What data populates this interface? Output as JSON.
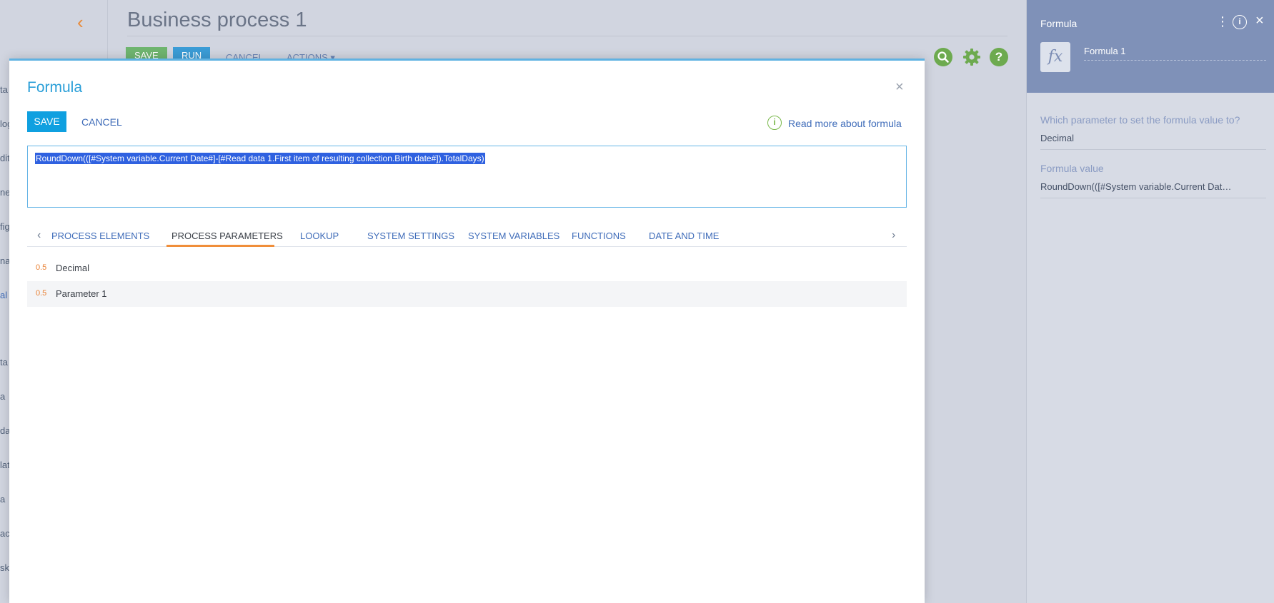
{
  "background": {
    "page_title": "Business process 1",
    "toolbar": {
      "save_label": "SAVE",
      "run_label": "RUN",
      "cancel_label": "CANCEL",
      "actions_label": "ACTIONS ▾"
    },
    "left_fragments": [
      "ta",
      "log",
      "dit",
      "ne",
      "fig",
      "nai",
      "al",
      "ta",
      "a",
      "dat",
      "lat",
      "a",
      "ac",
      "sk"
    ]
  },
  "right_panel": {
    "title": "Formula",
    "element_name": "Formula 1",
    "param_label": "Which parameter to set the formula value to?",
    "param_value": "Decimal",
    "formula_label": "Formula value",
    "formula_value": "RoundDown(([#System variable.Current Dat…"
  },
  "modal": {
    "title": "Formula",
    "save_label": "SAVE",
    "cancel_label": "CANCEL",
    "info_link": "Read more about formula",
    "formula": "RoundDown(([#System variable.Current Date#]-[#Read data 1.First item of resulting collection.Birth date#]).TotalDays)",
    "tabs": [
      {
        "label": "PROCESS ELEMENTS"
      },
      {
        "label": "PROCESS PARAMETERS"
      },
      {
        "label": "LOOKUP"
      },
      {
        "label": "SYSTEM SETTINGS"
      },
      {
        "label": "SYSTEM VARIABLES"
      },
      {
        "label": "FUNCTIONS"
      },
      {
        "label": "DATE AND TIME"
      }
    ],
    "active_tab": "PROCESS PARAMETERS",
    "parameters": [
      {
        "type": "0.5",
        "name": "Decimal"
      },
      {
        "type": "0.5",
        "name": "Parameter 1"
      }
    ]
  },
  "colors": {
    "accent_blue": "#0fa0e0",
    "link_blue": "#3f6cb9",
    "active_tab_underline": "#f08e3a",
    "panel_header": "#7f91b8"
  }
}
